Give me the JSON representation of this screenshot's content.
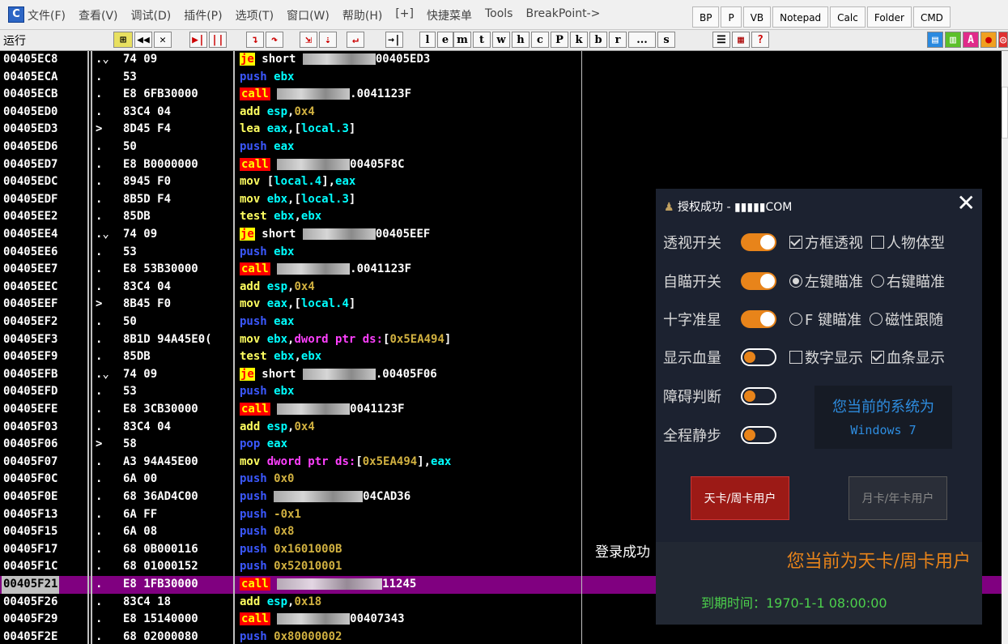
{
  "menu": {
    "logo": "C",
    "items": [
      "文件(F)",
      "查看(V)",
      "调试(D)",
      "插件(P)",
      "选项(T)",
      "窗口(W)",
      "帮助(H)",
      "[+]",
      "快捷菜单",
      "Tools",
      "BreakPoint->"
    ],
    "ext_buttons": [
      "BP",
      "P",
      "VB",
      "Notepad",
      "Calc",
      "Folder",
      "CMD"
    ]
  },
  "toolbar": {
    "status": "运行",
    "letters": [
      "l",
      "e",
      "m",
      "t",
      "w",
      "h",
      "c",
      "P",
      "k",
      "b",
      "r",
      "...",
      "s"
    ]
  },
  "disasm": {
    "rows": [
      {
        "addr": "00405EC8",
        "mark": ".⌄",
        "hex": "74 09",
        "op": "je",
        "op_class": "op-je",
        "args": "short ",
        "blur": 90,
        "tail": "00405ED3"
      },
      {
        "addr": "00405ECA",
        "mark": ".",
        "hex": "53",
        "op": "push",
        "op_class": "op-push",
        "args": "ebx"
      },
      {
        "addr": "00405ECB",
        "mark": ".",
        "hex": "E8 6FB30000",
        "op": "call",
        "op_class": "op-call",
        "args": " ",
        "blur": 90,
        "tail": ".0041123F"
      },
      {
        "addr": "00405ED0",
        "mark": ".",
        "hex": "83C4 04",
        "op": "add",
        "op_class": "op-norm",
        "args": "esp,0x4"
      },
      {
        "addr": "00405ED3",
        "mark": ">",
        "hex": "8D45 F4",
        "op": "lea",
        "op_class": "op-norm",
        "args": "eax,[local.3]"
      },
      {
        "addr": "00405ED6",
        "mark": ".",
        "hex": "50",
        "op": "push",
        "op_class": "op-push",
        "args": "eax"
      },
      {
        "addr": "00405ED7",
        "mark": ".",
        "hex": "E8 B0000000",
        "op": "call",
        "op_class": "op-call",
        "args": " ",
        "blur": 90,
        "tail": "00405F8C"
      },
      {
        "addr": "00405EDC",
        "mark": ".",
        "hex": "8945 F0",
        "op": "mov",
        "op_class": "op-norm",
        "args": "[local.4],eax"
      },
      {
        "addr": "00405EDF",
        "mark": ".",
        "hex": "8B5D F4",
        "op": "mov",
        "op_class": "op-norm",
        "args": "ebx,[local.3]"
      },
      {
        "addr": "00405EE2",
        "mark": ".",
        "hex": "85DB",
        "op": "test",
        "op_class": "op-norm",
        "args": "ebx,ebx"
      },
      {
        "addr": "00405EE4",
        "mark": ".⌄",
        "hex": "74 09",
        "op": "je",
        "op_class": "op-je",
        "args": "short ",
        "blur": 90,
        "tail": "00405EEF"
      },
      {
        "addr": "00405EE6",
        "mark": ".",
        "hex": "53",
        "op": "push",
        "op_class": "op-push",
        "args": "ebx"
      },
      {
        "addr": "00405EE7",
        "mark": ".",
        "hex": "E8 53B30000",
        "op": "call",
        "op_class": "op-call",
        "args": " ",
        "blur": 90,
        "tail": ".0041123F"
      },
      {
        "addr": "00405EEC",
        "mark": ".",
        "hex": "83C4 04",
        "op": "add",
        "op_class": "op-norm",
        "args": "esp,0x4"
      },
      {
        "addr": "00405EEF",
        "mark": ">",
        "hex": "8B45 F0",
        "op": "mov",
        "op_class": "op-norm",
        "args": "eax,[local.4]"
      },
      {
        "addr": "00405EF2",
        "mark": ".",
        "hex": "50",
        "op": "push",
        "op_class": "op-push",
        "args": "eax"
      },
      {
        "addr": "00405EF3",
        "mark": ".",
        "hex": "8B1D 94A45E0(",
        "op": "mov",
        "op_class": "op-norm",
        "args": "ebx,dword ptr ds:[0x5EA494]"
      },
      {
        "addr": "00405EF9",
        "mark": ".",
        "hex": "85DB",
        "op": "test",
        "op_class": "op-norm",
        "args": "ebx,ebx"
      },
      {
        "addr": "00405EFB",
        "mark": ".⌄",
        "hex": "74 09",
        "op": "je",
        "op_class": "op-je",
        "args": "short ",
        "blur": 90,
        "tail": ".00405F06"
      },
      {
        "addr": "00405EFD",
        "mark": ".",
        "hex": "53",
        "op": "push",
        "op_class": "op-push",
        "args": "ebx"
      },
      {
        "addr": "00405EFE",
        "mark": ".",
        "hex": "E8 3CB30000",
        "op": "call",
        "op_class": "op-call",
        "args": " ",
        "blur": 90,
        "tail": "0041123F"
      },
      {
        "addr": "00405F03",
        "mark": ".",
        "hex": "83C4 04",
        "op": "add",
        "op_class": "op-norm",
        "args": "esp,0x4"
      },
      {
        "addr": "00405F06",
        "mark": ">",
        "hex": "58",
        "op": "pop",
        "op_class": "op-pop",
        "args": "eax"
      },
      {
        "addr": "00405F07",
        "mark": ".",
        "hex": "A3 94A45E00",
        "op": "mov",
        "op_class": "op-norm",
        "args": "dword ptr ds:[0x5EA494],eax"
      },
      {
        "addr": "00405F0C",
        "mark": ".",
        "hex": "6A 00",
        "op": "push",
        "op_class": "op-push",
        "args": "0x0"
      },
      {
        "addr": "00405F0E",
        "mark": ".",
        "hex": "68 36AD4C00",
        "op": "push",
        "op_class": "op-push",
        "args": " ",
        "blur": 110,
        "tail": "04CAD36"
      },
      {
        "addr": "00405F13",
        "mark": ".",
        "hex": "6A FF",
        "op": "push",
        "op_class": "op-push",
        "args": "-0x1"
      },
      {
        "addr": "00405F15",
        "mark": ".",
        "hex": "6A 08",
        "op": "push",
        "op_class": "op-push",
        "args": "0x8"
      },
      {
        "addr": "00405F17",
        "mark": ".",
        "hex": "68 0B000116",
        "op": "push",
        "op_class": "op-push",
        "args": "0x1601000B"
      },
      {
        "addr": "00405F1C",
        "mark": ".",
        "hex": "68 01000152",
        "op": "push",
        "op_class": "op-push",
        "args": "0x52010001"
      },
      {
        "addr": "00405F21",
        "mark": ".",
        "hex": "E8 1FB30000",
        "op": "call",
        "op_class": "op-call",
        "args": " ",
        "blur": 130,
        "tail": "11245",
        "selected": true
      },
      {
        "addr": "00405F26",
        "mark": ".",
        "hex": "83C4 18",
        "op": "add",
        "op_class": "op-norm",
        "args": "esp,0x18"
      },
      {
        "addr": "00405F29",
        "mark": ".",
        "hex": "E8 15140000",
        "op": "call",
        "op_class": "op-call",
        "args": " ",
        "blur": 90,
        "tail": "00407343"
      },
      {
        "addr": "00405F2E",
        "mark": ".",
        "hex": "68 02000080",
        "op": "push",
        "op_class": "op-push",
        "args": "0x80000002"
      }
    ],
    "login_text": "登录成功"
  },
  "panel": {
    "title": "授权成功 - ▮▮▮▮▮COM",
    "close": "✕",
    "rows": [
      {
        "label": "透视开关",
        "toggle": "on",
        "opts": [
          {
            "kind": "box",
            "checked": true,
            "text": "方框透视"
          },
          {
            "kind": "box",
            "checked": false,
            "text": "人物体型"
          }
        ]
      },
      {
        "label": "自瞄开关",
        "toggle": "on",
        "opts": [
          {
            "kind": "radio",
            "checked": true,
            "text": "左键瞄准"
          },
          {
            "kind": "radio",
            "checked": false,
            "text": "右键瞄准"
          }
        ]
      },
      {
        "label": "十字准星",
        "toggle": "on",
        "opts": [
          {
            "kind": "radio",
            "checked": false,
            "text": "F 键瞄准"
          },
          {
            "kind": "radio",
            "checked": false,
            "text": "磁性跟随"
          }
        ]
      },
      {
        "label": "显示血量",
        "toggle": "off",
        "opts": [
          {
            "kind": "box",
            "checked": false,
            "text": "数字显示"
          },
          {
            "kind": "box",
            "checked": true,
            "text": "血条显示"
          }
        ]
      },
      {
        "label": "障碍判断",
        "toggle": "off",
        "opts": []
      },
      {
        "label": "全程静步",
        "toggle": "off",
        "opts": []
      }
    ],
    "system_line1": "您当前的系统为",
    "system_line2": "Windows 7",
    "day_card_btn": "天卡/周卡用户",
    "month_card_btn": "月卡/年卡用户",
    "current_user": "您当前为天卡/周卡用户",
    "expiry": "到期时间：1970-1-1 08:00:00"
  },
  "colors": {
    "accent": "#e8841a",
    "panel_bg": "#1c2230",
    "selected_row": "#800080"
  }
}
